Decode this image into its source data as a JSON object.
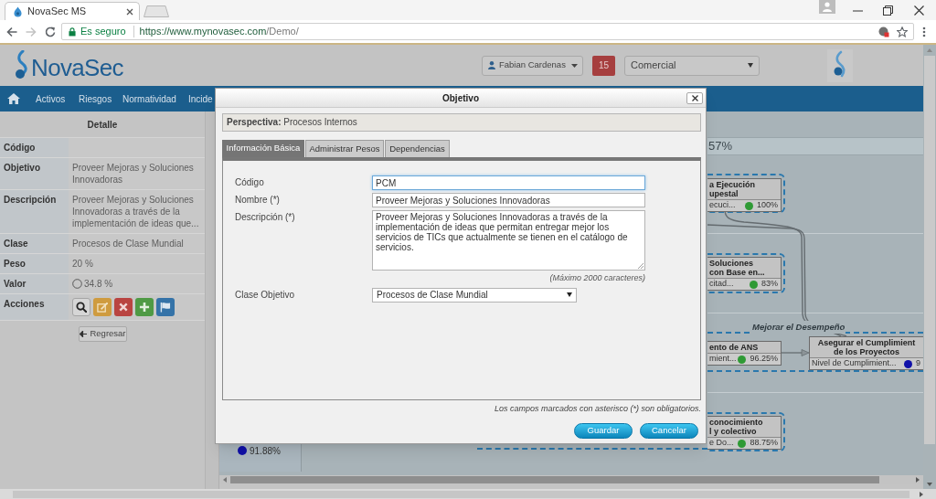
{
  "browser": {
    "tab_title": "NovaSec MS",
    "security_label": "Es seguro",
    "url_host": "https://www.mynovasec.com",
    "url_path": "/Demo/"
  },
  "header": {
    "brand": "NovaSec",
    "user": "Fabian Cardenas",
    "notifications": "15",
    "company": "Comercial"
  },
  "nav": {
    "items": [
      "Activos",
      "Riesgos",
      "Normatividad",
      "Incide"
    ]
  },
  "detail": {
    "title": "Detalle",
    "rows": [
      {
        "kind": "text",
        "label": "Código"
      },
      {
        "kind": "text",
        "label": "Objetivo",
        "value": "Proveer Mejoras y Soluciones Innovadoras"
      },
      {
        "kind": "text",
        "label": "Descripción",
        "value": "Proveer Mejoras y Soluciones Innovadoras a través de la implementación de ideas que..."
      },
      {
        "kind": "text",
        "label": "Clase",
        "value": "Procesos de Clase Mundial"
      },
      {
        "kind": "text",
        "label": "Peso",
        "value": "20 %"
      },
      {
        "kind": "status",
        "label": "Valor",
        "value": "34.8 %"
      },
      {
        "kind": "actions",
        "label": "Acciones",
        "actions": [
          {
            "kind": "search"
          },
          {
            "kind": "edit"
          },
          {
            "kind": "delete"
          },
          {
            "kind": "add"
          },
          {
            "kind": "flag"
          }
        ]
      }
    ],
    "back_button": "Regresar"
  },
  "map": {
    "score": "57%",
    "lane_label": "Mejorar el Desempeño",
    "summary": {
      "value": "91.88%",
      "color": "#1010a8"
    },
    "nodes": [
      {
        "title_lines": [
          "a Ejecución",
          "upestal"
        ],
        "indicator": "ecuci...",
        "value": "100%",
        "color": "#2f9a35"
      },
      {
        "title_lines": [
          "Soluciones",
          "con Base en..."
        ],
        "indicator": "citad...",
        "value": "83%",
        "color": "#2f9a35"
      },
      {
        "title_lines": [
          "ento de ANS"
        ],
        "indicator": "mient...",
        "value": "96.25%",
        "color": "#2f9a35"
      },
      {
        "title_lines": [
          "Asegurar el Cumplimient",
          "de los Proyectos"
        ],
        "indicator": "Nivel de Cumplimient...",
        "value": "9",
        "color": "#1010a8"
      },
      {
        "title_lines": [
          "conocimiento",
          "l y colectivo"
        ],
        "indicator": "e Do...",
        "value": "88.75%",
        "color": "#2f9a35"
      }
    ]
  },
  "dialog": {
    "title": "Objetivo",
    "perspective": "**Perspectiva:** Procesos Internos",
    "tabs": [
      {
        "label": "Información Básica",
        "selected": true
      },
      {
        "label": "Administrar Pesos",
        "selected": false
      },
      {
        "label": "Dependencias",
        "selected": false
      }
    ],
    "fields": [
      {
        "kind": "text",
        "label": "Código",
        "value": "PCM",
        "focused": true
      },
      {
        "kind": "text",
        "label": "Nombre (*)",
        "value": "Proveer Mejoras y Soluciones Innovadoras",
        "focused": false
      },
      {
        "kind": "textarea",
        "label": "Descripción (*)",
        "value": "Proveer Mejoras y Soluciones Innovadoras a través de la implementación de ideas que permitan entregar mejor los servicios de TICs que actualmente se tienen en el catálogo de servicios.",
        "hint": "(Máximo 2000 caracteres)",
        "focused": false
      },
      {
        "kind": "select",
        "label": "Clase Objetivo",
        "value": "Procesos de Clase Mundial",
        "focused": false
      }
    ],
    "note": "Los campos marcados con asterisco (*) son obligatorios.",
    "buttons": [
      "Guardar",
      "Cancelar"
    ]
  }
}
